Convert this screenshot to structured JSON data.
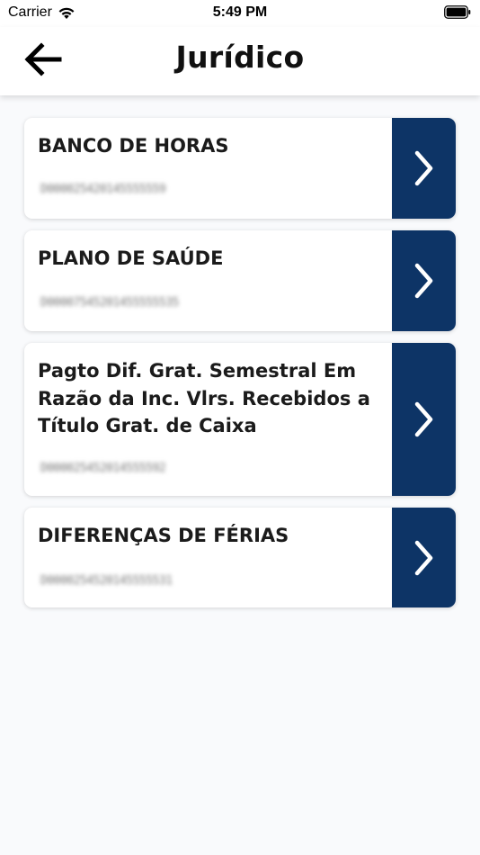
{
  "status_bar": {
    "carrier": "Carrier",
    "time": "5:49 PM"
  },
  "header": {
    "title": "Jurídico",
    "back_icon": "arrow-left-icon"
  },
  "items": [
    {
      "title": "BANCO DE HORAS",
      "code": "D000025420145555559"
    },
    {
      "title": "PLANO DE SAÚDE",
      "code": "D00007545201455555535"
    },
    {
      "title": "Pagto Dif. Grat. Semestral Em Razão da Inc. Vlrs. Recebidos a Título Grat. de Caixa",
      "code": "D000025452014555592"
    },
    {
      "title": "DIFERENÇAS DE FÉRIAS",
      "code": "D0000254520145555531"
    }
  ],
  "colors": {
    "accent": "#0d3466",
    "background": "#f9fafc",
    "card": "#ffffff"
  }
}
